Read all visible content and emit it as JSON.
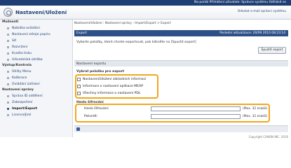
{
  "topbar": {
    "text": "Na portál   Přihlášení uživatele: Správce systému Odhlásit se"
  },
  "header": {
    "title": "Nastavení/Uložení",
    "logout_link": "Odeslat o-mail správci systému"
  },
  "sidebar": {
    "sections": [
      {
        "label": "Možnosti",
        "items": [
          "Nabídka ovládání",
          "Nastavení zdroje papíru",
          "Síť",
          "Rozvržení",
          "Kvalita tisku",
          "Uživatelská údržba"
        ]
      },
      {
        "label": "Výstup/Kontrola",
        "items": [
          "Útility Menu",
          "Kalibrace",
          "Ovládání zařízení"
        ]
      },
      {
        "label": "Nastavení správy",
        "items": [
          "Správa ID oddělení",
          "Zabezpečení",
          "Import/Export",
          "Licence/Jiné"
        ]
      }
    ],
    "active_item": "Import/Export"
  },
  "main": {
    "breadcrumb": "Nastavení/Uložení : Nastavení správy : Import/Export > Export",
    "panel_title": "Export",
    "last_update": "Poslední aktualizace: 20/09 2010 08:23:14",
    "instruction": "Vyberte položky, které chcete exportovat, pak klikněte na [Spustit export]",
    "export_button": "Spustit export",
    "section_title": "Nastavení exportu",
    "select_label": "Vybrat položku pro export",
    "options": [
      "Nastavení/Uložení základních informací",
      "Informace o nastavení aplikace MEAP",
      "Všechny informace o nastavení PDL"
    ],
    "password_label": "Heslo šifrování",
    "password_fields": [
      {
        "label": "Heslo šifrování:",
        "note": "(Max. 32 znaků)"
      },
      {
        "label": "Potvrdit:",
        "note": "(Max. 32 znaků)"
      }
    ],
    "copyright": "Copyright CANON INC. 2016"
  },
  "colors": {
    "brand": "#1f3f74",
    "highlight": "#f0a71d",
    "panel_bar": "#2e5088"
  }
}
